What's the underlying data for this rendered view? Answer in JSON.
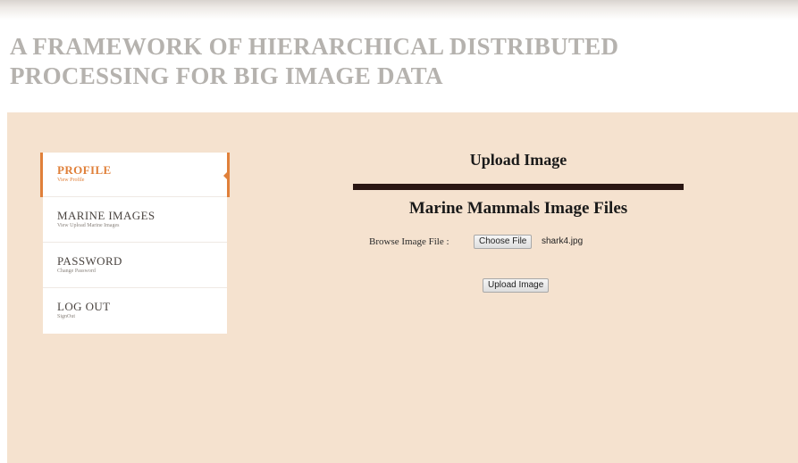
{
  "header": {
    "title_line1": "A FRAMEWORK OF HIERARCHICAL DISTRIBUTED",
    "title_line2": "PROCESSING FOR BIG IMAGE DATA"
  },
  "sidebar": {
    "accent_color": "#e0803a",
    "items": [
      {
        "label": "PROFILE",
        "sub": "View Profile",
        "active": true
      },
      {
        "label": "MARINE IMAGES",
        "sub": "View Upload Marine Images",
        "active": false
      },
      {
        "label": "PASSWORD",
        "sub": "Change Password",
        "active": false
      },
      {
        "label": "LOG OUT",
        "sub": "SignOut",
        "active": false
      }
    ]
  },
  "content": {
    "upload_title": "Upload Image",
    "files_title": "Marine Mammals Image Files",
    "browse_label": "Browse Image File :",
    "choose_file_label": "Choose File",
    "selected_file": "shark4.jpg",
    "upload_button_label": "Upload Image"
  },
  "colors": {
    "background": "#f5e2cf",
    "header_text": "#b5b2ae",
    "divider": "#2a1612"
  }
}
